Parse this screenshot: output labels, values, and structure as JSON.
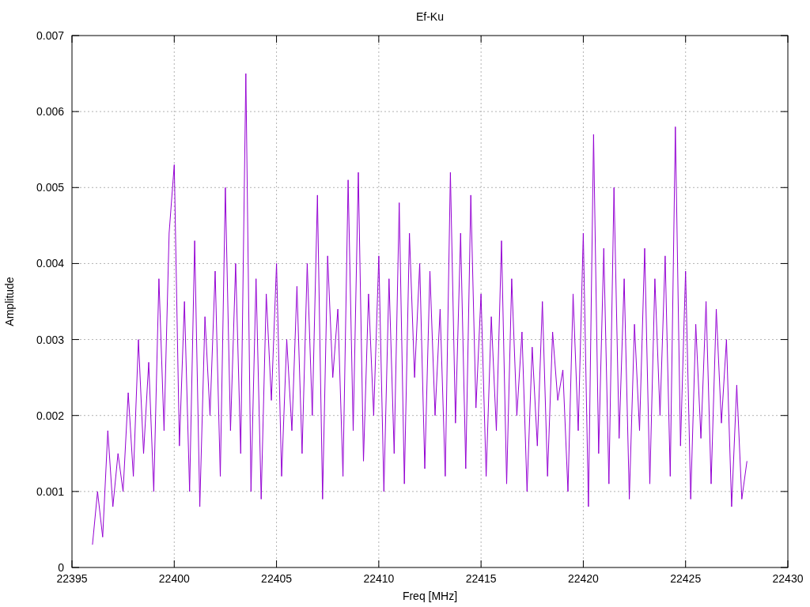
{
  "chart": {
    "chart_data": {
      "type": "line",
      "title": "Ef-Ku",
      "xlabel": "Freq [MHz]",
      "ylabel": "Amplitude",
      "x": [
        22396,
        22396.25,
        22396.5,
        22396.75,
        22397,
        22397.25,
        22397.5,
        22397.75,
        22398,
        22398.25,
        22398.5,
        22398.75,
        22399,
        22399.25,
        22399.5,
        22399.75,
        22400,
        22400.25,
        22400.5,
        22400.75,
        22401,
        22401.25,
        22401.5,
        22401.75,
        22402,
        22402.25,
        22402.5,
        22402.75,
        22403,
        22403.25,
        22403.5,
        22403.75,
        22404,
        22404.25,
        22404.5,
        22404.75,
        22405,
        22405.25,
        22405.5,
        22405.75,
        22406,
        22406.25,
        22406.5,
        22406.75,
        22407,
        22407.25,
        22407.5,
        22407.75,
        22408,
        22408.25,
        22408.5,
        22408.75,
        22409,
        22409.25,
        22409.5,
        22409.75,
        22410,
        22410.25,
        22410.5,
        22410.75,
        22411,
        22411.25,
        22411.5,
        22411.75,
        22412,
        22412.25,
        22412.5,
        22412.75,
        22413,
        22413.25,
        22413.5,
        22413.75,
        22414,
        22414.25,
        22414.5,
        22414.75,
        22415,
        22415.25,
        22415.5,
        22415.75,
        22416,
        22416.25,
        22416.5,
        22416.75,
        22417,
        22417.25,
        22417.5,
        22417.75,
        22418,
        22418.25,
        22418.5,
        22418.75,
        22419,
        22419.25,
        22419.5,
        22419.75,
        22420,
        22420.25,
        22420.5,
        22420.75,
        22421,
        22421.25,
        22421.5,
        22421.75,
        22422,
        22422.25,
        22422.5,
        22422.75,
        22423,
        22423.25,
        22423.5,
        22423.75,
        22424,
        22424.25,
        22424.5,
        22424.75,
        22425,
        22425.25,
        22425.5,
        22425.75,
        22426,
        22426.25,
        22426.5,
        22426.75,
        22427,
        22427.25,
        22427.5,
        22427.75,
        22428
      ],
      "series": [
        {
          "color": "#9400d3",
          "values": [
            0.0003,
            0.001,
            0.0004,
            0.0018,
            0.0008,
            0.0015,
            0.001,
            0.0023,
            0.0012,
            0.003,
            0.0015,
            0.0027,
            0.001,
            0.0038,
            0.0018,
            0.0044,
            0.0053,
            0.0016,
            0.0035,
            0.001,
            0.0043,
            0.0008,
            0.0033,
            0.002,
            0.0039,
            0.0012,
            0.005,
            0.0018,
            0.004,
            0.0015,
            0.0065,
            0.001,
            0.0038,
            0.0009,
            0.0036,
            0.0022,
            0.004,
            0.0012,
            0.003,
            0.0018,
            0.0037,
            0.0015,
            0.004,
            0.002,
            0.0049,
            0.0009,
            0.0041,
            0.0025,
            0.0034,
            0.0012,
            0.0051,
            0.0018,
            0.0052,
            0.0014,
            0.0036,
            0.002,
            0.0041,
            0.001,
            0.0038,
            0.0015,
            0.0048,
            0.0011,
            0.0044,
            0.0025,
            0.004,
            0.0013,
            0.0039,
            0.002,
            0.0034,
            0.0012,
            0.0052,
            0.0019,
            0.0044,
            0.0013,
            0.0049,
            0.0021,
            0.0036,
            0.0012,
            0.0033,
            0.0018,
            0.0043,
            0.0011,
            0.0038,
            0.002,
            0.0031,
            0.001,
            0.0029,
            0.0016,
            0.0035,
            0.0012,
            0.0031,
            0.0022,
            0.0026,
            0.001,
            0.0036,
            0.0018,
            0.0044,
            0.0008,
            0.0057,
            0.0015,
            0.0042,
            0.0011,
            0.005,
            0.0017,
            0.0038,
            0.0009,
            0.0032,
            0.0018,
            0.0042,
            0.0011,
            0.0038,
            0.002,
            0.0041,
            0.0012,
            0.0058,
            0.0016,
            0.0039,
            0.0009,
            0.0032,
            0.0017,
            0.0035,
            0.0011,
            0.0034,
            0.0019,
            0.003,
            0.0008,
            0.0024,
            0.0009,
            0.0014
          ]
        }
      ],
      "grid": true,
      "xlim": [
        22395,
        22430
      ],
      "ylim": [
        0,
        0.007
      ],
      "xticks": [
        22395,
        22400,
        22405,
        22410,
        22415,
        22420,
        22425,
        22430
      ],
      "yticks": [
        0,
        0.001,
        0.002,
        0.003,
        0.004,
        0.005,
        0.006,
        0.007
      ]
    }
  }
}
